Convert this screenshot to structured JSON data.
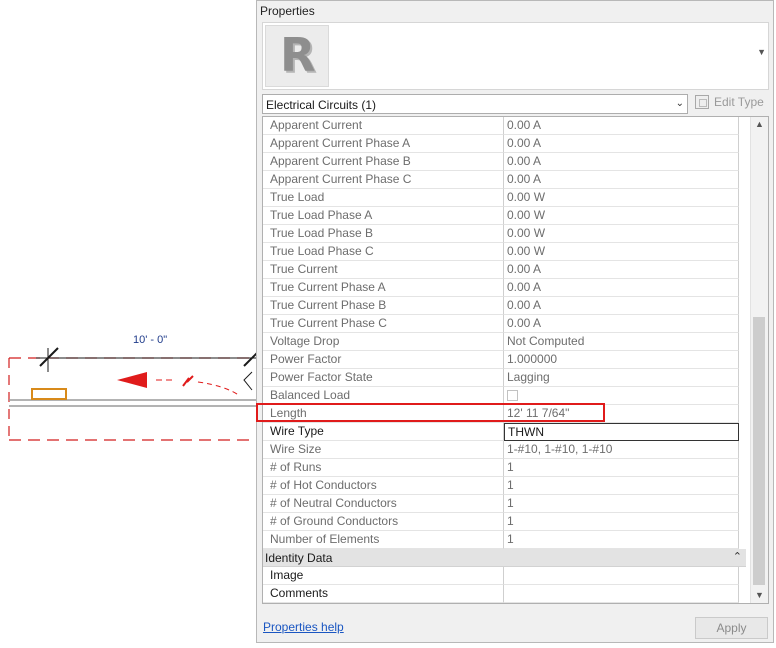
{
  "drawing": {
    "dimension_label": "10' - 0\""
  },
  "panel": {
    "title": "Properties",
    "type_logo": "R",
    "selector_label": "Electrical Circuits (1)",
    "edit_type_label": "Edit Type",
    "help_link": "Properties help",
    "apply_label": "Apply"
  },
  "rows": [
    {
      "name": "Apparent Current",
      "value": "0.00 A"
    },
    {
      "name": "Apparent Current Phase A",
      "value": "0.00 A"
    },
    {
      "name": "Apparent Current Phase B",
      "value": "0.00 A"
    },
    {
      "name": "Apparent Current Phase C",
      "value": "0.00 A"
    },
    {
      "name": "True Load",
      "value": "0.00 W"
    },
    {
      "name": "True Load Phase A",
      "value": "0.00 W"
    },
    {
      "name": "True Load Phase B",
      "value": "0.00 W"
    },
    {
      "name": "True Load Phase C",
      "value": "0.00 W"
    },
    {
      "name": "True Current",
      "value": "0.00 A"
    },
    {
      "name": "True Current Phase A",
      "value": "0.00 A"
    },
    {
      "name": "True Current Phase B",
      "value": "0.00 A"
    },
    {
      "name": "True Current Phase C",
      "value": "0.00 A"
    },
    {
      "name": "Voltage Drop",
      "value": "Not Computed"
    },
    {
      "name": "Power Factor",
      "value": "1.000000"
    },
    {
      "name": "Power Factor State",
      "value": "Lagging"
    },
    {
      "name": "Balanced Load",
      "value": ""
    },
    {
      "name": "Length",
      "value": "12'  11 7/64\""
    },
    {
      "name": "Wire Type",
      "value": "THWN"
    },
    {
      "name": "Wire Size",
      "value": "1-#10, 1-#10, 1-#10"
    },
    {
      "name": "# of Runs",
      "value": "1"
    },
    {
      "name": "# of Hot Conductors",
      "value": "1"
    },
    {
      "name": "# of Neutral Conductors",
      "value": "1"
    },
    {
      "name": "# of Ground Conductors",
      "value": "1"
    },
    {
      "name": "Number of Elements",
      "value": "1"
    }
  ],
  "identity_group": {
    "label": "Identity Data",
    "rows": [
      {
        "name": "Image",
        "value": ""
      },
      {
        "name": "Comments",
        "value": ""
      }
    ]
  },
  "colors": {
    "highlight": "#e01b1b",
    "link": "#1a56c2",
    "dimension": "#1f3b8a"
  }
}
